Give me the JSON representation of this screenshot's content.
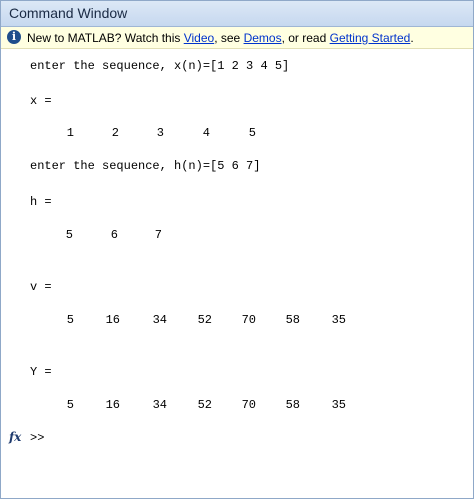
{
  "window": {
    "title": "Command Window"
  },
  "infobar": {
    "prefix": "New to MATLAB? Watch this ",
    "video_link": "Video",
    "mid1": ", see ",
    "demos_link": "Demos",
    "mid2": ", or read ",
    "getting_started_link": "Getting Started",
    "suffix": "."
  },
  "console": {
    "input1": "enter the sequence, x(n)=[1 2 3 4 5]",
    "x_label": "x =",
    "x_values": [
      "1",
      "2",
      "3",
      "4",
      "5"
    ],
    "input2": "enter the sequence, h(n)=[5 6 7]",
    "h_label": "h =",
    "h_values": [
      "5",
      "6",
      "7"
    ],
    "v_label": "v =",
    "v_values": [
      "5",
      "16",
      "34",
      "52",
      "70",
      "58",
      "35"
    ],
    "y_label": "Y =",
    "y_values": [
      "5",
      "16",
      "34",
      "52",
      "70",
      "58",
      "35"
    ],
    "prompt": ">>",
    "fx_icon": "fx"
  }
}
